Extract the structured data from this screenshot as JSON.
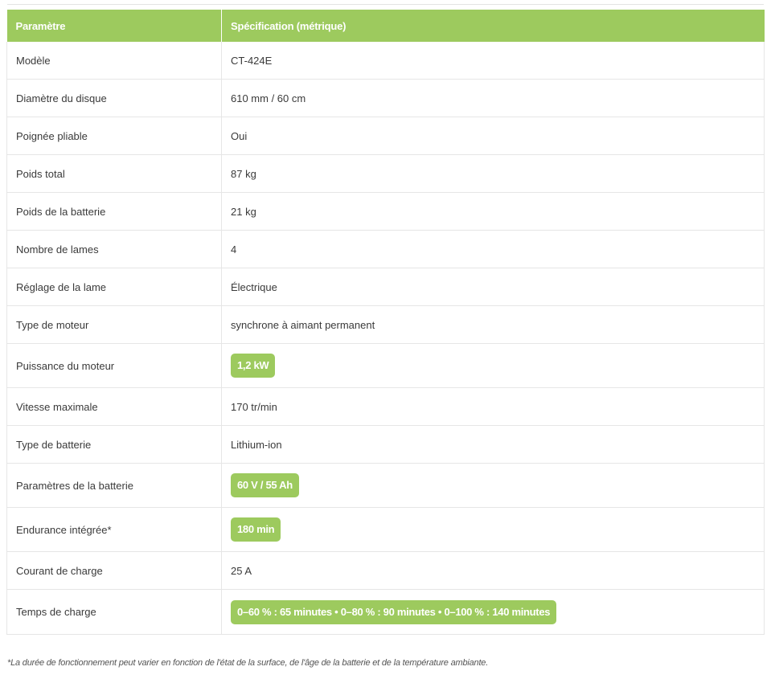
{
  "table": {
    "headers": {
      "param": "Paramètre",
      "value": "Spécification (métrique)"
    },
    "rows": [
      {
        "param": "Modèle",
        "value": "CT-424E",
        "highlight": false
      },
      {
        "param": "Diamètre du disque",
        "value": "610 mm / 60 cm",
        "highlight": false
      },
      {
        "param": "Poignée pliable",
        "value": "Oui",
        "highlight": false
      },
      {
        "param": "Poids total",
        "value": "87 kg",
        "highlight": false
      },
      {
        "param": "Poids de la batterie",
        "value": "21 kg",
        "highlight": false
      },
      {
        "param": "Nombre de lames",
        "value": "4",
        "highlight": false
      },
      {
        "param": "Réglage de la lame",
        "value": "Électrique",
        "highlight": false
      },
      {
        "param": "Type de moteur",
        "value": "synchrone à aimant permanent",
        "highlight": false
      },
      {
        "param": "Puissance du moteur",
        "value": "1,2 kW",
        "highlight": true
      },
      {
        "param": "Vitesse maximale",
        "value": "170 tr/min",
        "highlight": false
      },
      {
        "param": "Type de batterie",
        "value": "Lithium-ion",
        "highlight": false
      },
      {
        "param": "Paramètres de la batterie",
        "value": "60 V / 55 Ah",
        "highlight": true
      },
      {
        "param": "Endurance intégrée*",
        "value": "180 min",
        "highlight": true
      },
      {
        "param": "Courant de charge",
        "value": "25 A",
        "highlight": false
      },
      {
        "param": "Temps de charge",
        "value": "0–60 % : 65 minutes • 0–80 % : 90 minutes • 0–100 % : 140 minutes",
        "highlight": true
      }
    ]
  },
  "footnote": "*La durée de fonctionnement peut varier en fonction de l'état de la surface, de l'âge de la batterie et de la température ambiante.",
  "colors": {
    "accent": "#9dca5e",
    "border": "#e6e6e6",
    "text": "#3a3a3a"
  }
}
